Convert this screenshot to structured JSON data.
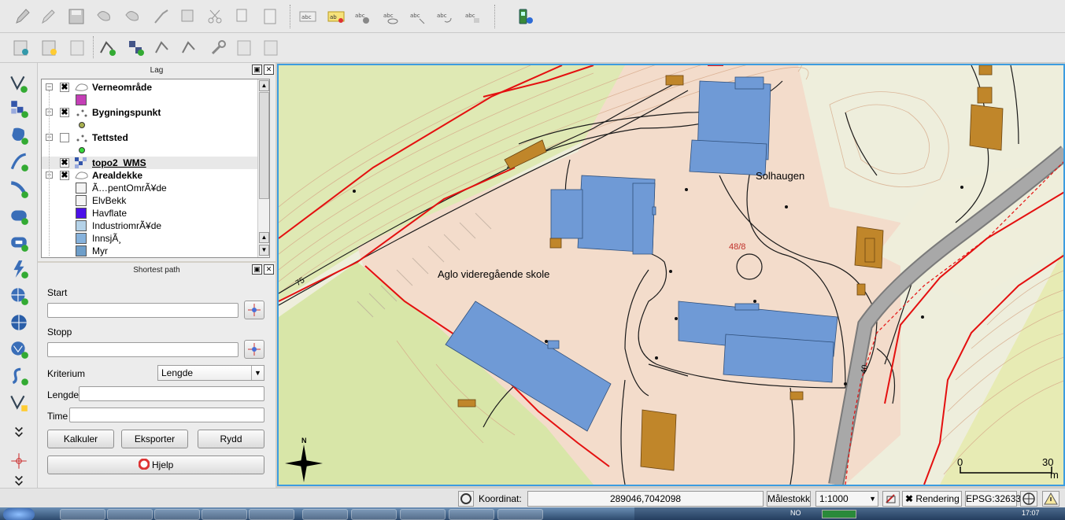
{
  "colors": {
    "map_border": "#3c9ce0",
    "building_blue": "#6f9ad6",
    "building_brown": "#c0862a",
    "property_line": "#e41010",
    "road_gray": "#9a9a9a",
    "residential_pink": "#f5d8c8",
    "forest_green": "#d8e6a8"
  },
  "layers_panel": {
    "title": "Lag",
    "items": [
      {
        "label": "Verneområde",
        "bold": true,
        "checked": true,
        "expanded": true,
        "type": "polygon"
      },
      {
        "label": "",
        "swatch": "#c43fb6",
        "type": "legend"
      },
      {
        "label": "Bygningspunkt",
        "bold": true,
        "checked": true,
        "expanded": true,
        "type": "point"
      },
      {
        "label": "",
        "swatch": "#a8b050",
        "type": "legend-point"
      },
      {
        "label": "Tettsted",
        "bold": true,
        "checked": false,
        "expanded": true,
        "type": "point"
      },
      {
        "label": "",
        "swatch": "#36d93a",
        "type": "legend-point"
      },
      {
        "label": "topo2_WMS",
        "bold": true,
        "checked": true,
        "expanded": false,
        "type": "raster"
      },
      {
        "label": "Arealdekke",
        "bold": true,
        "checked": true,
        "expanded": true,
        "type": "polygon"
      },
      {
        "label": "Ã…pentOmrÃ¥de",
        "swatch": "#f4f4f4",
        "type": "legend"
      },
      {
        "label": "ElvBekk",
        "swatch": "#f4f4f4",
        "type": "legend"
      },
      {
        "label": "Havflate",
        "swatch": "#4b10e8",
        "type": "legend"
      },
      {
        "label": "IndustriomrÃ¥de",
        "swatch": "#b4d2e8",
        "type": "legend"
      },
      {
        "label": "InnsjÃ¸",
        "swatch": "#86b2dc",
        "type": "legend"
      },
      {
        "label": "Myr",
        "swatch": "#6e9ec9",
        "type": "legend"
      }
    ]
  },
  "shortest_path": {
    "title": "Shortest path",
    "start_label": "Start",
    "start_value": "",
    "stopp_label": "Stopp",
    "stopp_value": "",
    "kriterium_label": "Kriterium",
    "kriterium_value": "Lengde",
    "lengde_label": "Lengde",
    "lengde_value": "",
    "time_label": "Time",
    "time_value": "",
    "btn_kalkuler": "Kalkuler",
    "btn_eksporter": "Eksporter",
    "btn_rydd": "Rydd",
    "btn_hjelp": "Hjelp"
  },
  "map": {
    "labels": {
      "solhaugen": "Solhaugen",
      "school": "Aglo videregående skole",
      "parcel": "48/8",
      "contour_75": "75",
      "road_40": "40",
      "north": "N"
    },
    "scalebar": {
      "start": "0",
      "end": "30",
      "unit": "m"
    }
  },
  "statusbar": {
    "koordinat_label": "Koordinat:",
    "koordinat_value": "289046,7042098",
    "malestokk_label": "Målestokk",
    "malestokk_value": "1:1000",
    "rendering_label": "Rendering",
    "rendering_checked": true,
    "crs": "EPSG:32633"
  },
  "taskbar": {
    "time": "17:07",
    "lang": "NO"
  }
}
